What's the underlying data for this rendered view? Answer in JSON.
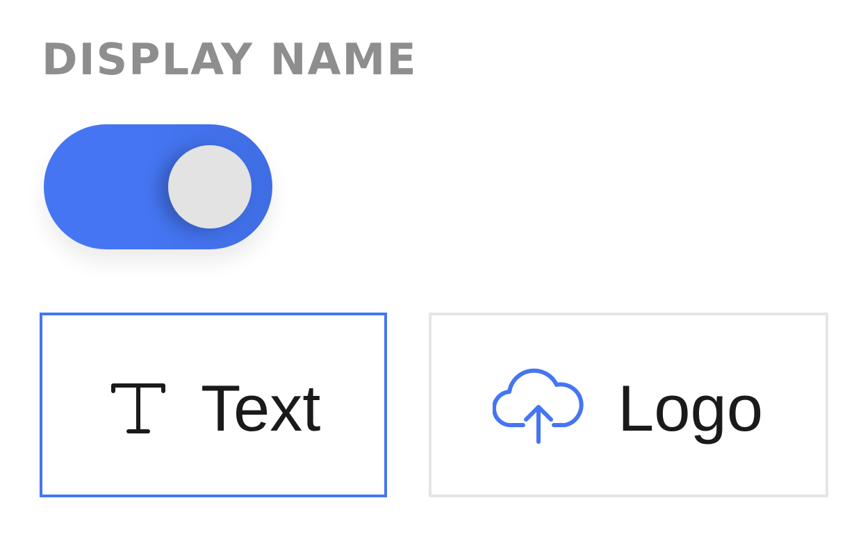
{
  "display_name": {
    "section_label": "DISPLAY NAME",
    "toggle": {
      "state": "on",
      "color": "#4575f2",
      "knob_color": "#e3e3e3"
    },
    "options": [
      {
        "label": "Text",
        "icon": "text-type-icon",
        "selected": true
      },
      {
        "label": "Logo",
        "icon": "cloud-upload-icon",
        "selected": false
      }
    ]
  },
  "colors": {
    "accent": "#4575f2",
    "label_gray": "#8e8e8e",
    "border_unselected": "#e5e5e5",
    "text": "#1a1a1a"
  }
}
